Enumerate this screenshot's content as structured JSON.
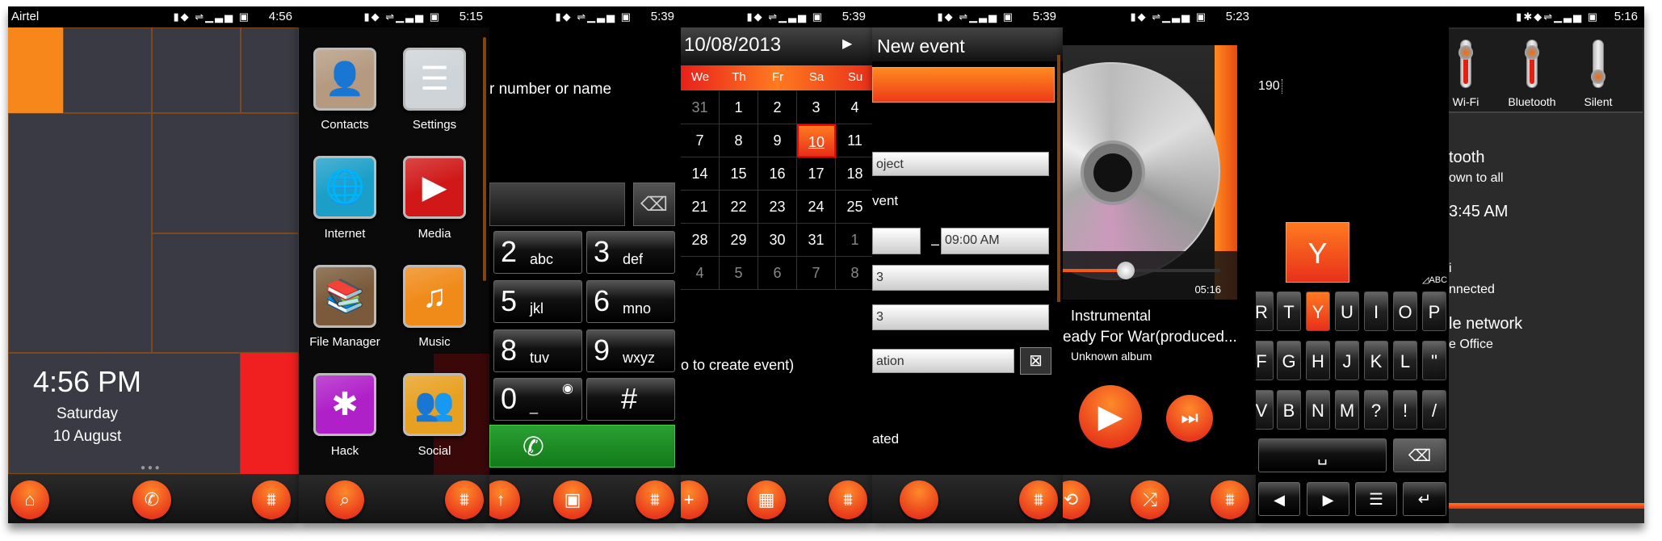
{
  "colors": {
    "accent": "#f26a1b",
    "accent_red": "#e8301a",
    "call_green": "#1e8a24"
  },
  "home": {
    "carrier": "Airtel",
    "time": "4:56",
    "clock": "4:56 PM",
    "day": "Saturday",
    "date": "10 August",
    "buttons": [
      "home-icon",
      "phone-icon",
      "settings-sliders-icon"
    ]
  },
  "menu": {
    "time": "5:15",
    "apps": [
      {
        "label": "Contacts",
        "icon": "contacts-icon",
        "color": "#b59a80",
        "glyph": "👤"
      },
      {
        "label": "Settings",
        "icon": "settings-icon",
        "color": "#cfd4d8",
        "glyph": "☰"
      },
      {
        "label": "Internet",
        "icon": "globe-icon",
        "color": "#1b9fc8",
        "glyph": "🌐"
      },
      {
        "label": "Media",
        "icon": "play-icon",
        "color": "#d01818",
        "glyph": "▶"
      },
      {
        "label": "File Manager",
        "icon": "bookshelf-icon",
        "color": "#7a5a3a",
        "glyph": "📚"
      },
      {
        "label": "Music",
        "icon": "music-note-icon",
        "color": "#f08a18",
        "glyph": "♫"
      },
      {
        "label": "Hack",
        "icon": "asterisk-icon",
        "color": "#b020c8",
        "glyph": "✱"
      },
      {
        "label": "Social",
        "icon": "people-icon",
        "color": "#e8a020",
        "glyph": "👥"
      }
    ]
  },
  "dialer": {
    "time": "5:39",
    "prompt": "r number or name",
    "keys": [
      {
        "d": "2",
        "l": "abc"
      },
      {
        "d": "3",
        "l": "def"
      },
      {
        "d": "5",
        "l": "jkl"
      },
      {
        "d": "6",
        "l": "mno"
      },
      {
        "d": "8",
        "l": "tuv"
      },
      {
        "d": "9",
        "l": "wxyz"
      },
      {
        "d": "0",
        "l": "_"
      },
      {
        "d": "#",
        "l": ""
      }
    ]
  },
  "calendar": {
    "time": "5:39",
    "date": "10/08/2013",
    "weekdays": [
      "We",
      "Th",
      "Fr",
      "Sa",
      "Su"
    ],
    "weeks": [
      [
        31,
        1,
        2,
        3,
        4
      ],
      [
        7,
        8,
        9,
        10,
        11
      ],
      [
        14,
        15,
        16,
        17,
        18
      ],
      [
        21,
        22,
        23,
        24,
        25
      ],
      [
        28,
        29,
        30,
        31,
        1
      ],
      [
        4,
        5,
        6,
        7,
        8
      ]
    ],
    "selected": 10,
    "event_days": [
      3,
      8,
      17
    ],
    "hint": "o to create event)"
  },
  "event": {
    "time": "5:39",
    "title": "New event",
    "subject": "oject",
    "event_label": "vent",
    "start": "",
    "end": "09:00 AM",
    "date1": "3",
    "date2": "3",
    "location": "ation",
    "footer": "ated"
  },
  "music": {
    "time": "5:23",
    "elapsed": "05:16",
    "progress_fraction": 0.4,
    "genre": "Instrumental",
    "track": "eady For War(produced...",
    "album": "Unknown album"
  },
  "keyboard": {
    "input": "190",
    "preview": "Y",
    "mode": "ABC",
    "rows": [
      [
        "R",
        "T",
        "Y",
        "U",
        "I",
        "O",
        "P"
      ],
      [
        "F",
        "G",
        "H",
        "J",
        "K",
        "L",
        "\""
      ],
      [
        "V",
        "B",
        "N",
        "M",
        "?",
        "!",
        "/"
      ]
    ],
    "highlight": "Y"
  },
  "settings": {
    "time": "5:16",
    "toggles": [
      {
        "label": "Wi-Fi",
        "on": true
      },
      {
        "label": "Bluetooth",
        "on": true
      },
      {
        "label": "Silent",
        "on": false
      }
    ],
    "lines": [
      "tooth",
      "own to all",
      "3:45 AM",
      "i",
      "nnected",
      "le network",
      "e Office"
    ]
  }
}
